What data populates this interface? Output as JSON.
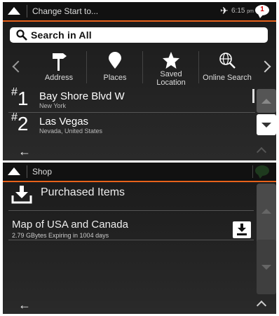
{
  "screen1": {
    "title": "Change Start to...",
    "time": "6:15",
    "time_suffix": "pm",
    "notification_count": "1",
    "search_label": "Search in All",
    "categories": [
      {
        "label": "Address",
        "icon": "signpost-icon"
      },
      {
        "label": "Places",
        "icon": "place-pin-icon"
      },
      {
        "label": "Saved Location",
        "icon": "star-icon"
      },
      {
        "label": "Online Search",
        "icon": "globe-search-icon"
      }
    ],
    "results": [
      {
        "rank": "1",
        "name": "Bay Shore Blvd W",
        "sub": "New York"
      },
      {
        "rank": "2",
        "name": "Las Vegas",
        "sub": "Nevada, United States"
      }
    ],
    "back_glyph": "←"
  },
  "screen2": {
    "title": "Shop",
    "purchased_label": "Purchased Items",
    "item": {
      "name": "Map of USA and Canada",
      "details": "2.79 GBytes  Expiring in 1004 days"
    },
    "back_glyph": "←"
  },
  "colors": {
    "accent": "#e8621b"
  }
}
